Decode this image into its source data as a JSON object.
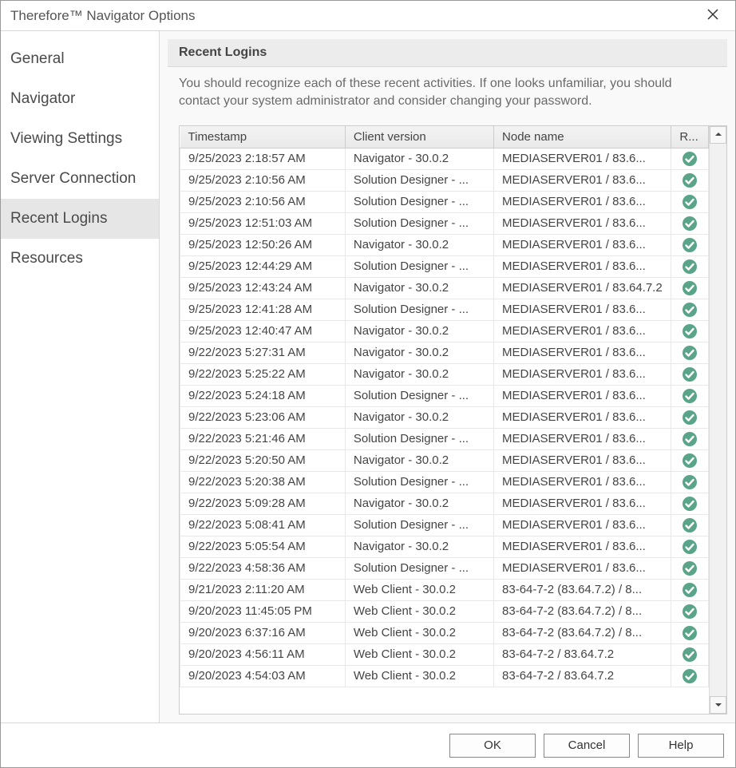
{
  "window": {
    "title": "Therefore™ Navigator Options"
  },
  "sidebar": {
    "items": [
      {
        "label": "General"
      },
      {
        "label": "Navigator"
      },
      {
        "label": "Viewing Settings"
      },
      {
        "label": "Server Connection"
      },
      {
        "label": "Recent Logins"
      },
      {
        "label": "Resources"
      }
    ],
    "active_index": 4
  },
  "main": {
    "heading": "Recent Logins",
    "description": "You should recognize each of these recent activities. If one looks unfamiliar, you should contact your system administrator and consider changing your password.",
    "columns": {
      "timestamp": "Timestamp",
      "client_version": "Client version",
      "node_name": "Node name",
      "result": "R..."
    },
    "rows": [
      {
        "ts": "9/25/2023 2:18:57 AM",
        "cv": "Navigator - 30.0.2",
        "nn": "MEDIASERVER01 / 83.6...",
        "ok": true
      },
      {
        "ts": "9/25/2023 2:10:56 AM",
        "cv": "Solution Designer - ...",
        "nn": "MEDIASERVER01 / 83.6...",
        "ok": true
      },
      {
        "ts": "9/25/2023 2:10:56 AM",
        "cv": "Solution Designer - ...",
        "nn": "MEDIASERVER01 / 83.6...",
        "ok": true
      },
      {
        "ts": "9/25/2023 12:51:03 AM",
        "cv": "Solution Designer - ...",
        "nn": "MEDIASERVER01 / 83.6...",
        "ok": true
      },
      {
        "ts": "9/25/2023 12:50:26 AM",
        "cv": "Navigator - 30.0.2",
        "nn": "MEDIASERVER01 / 83.6...",
        "ok": true
      },
      {
        "ts": "9/25/2023 12:44:29 AM",
        "cv": "Solution Designer - ...",
        "nn": "MEDIASERVER01 / 83.6...",
        "ok": true
      },
      {
        "ts": "9/25/2023 12:43:24 AM",
        "cv": "Navigator - 30.0.2",
        "nn": "MEDIASERVER01 / 83.64.7.2",
        "ok": true,
        "highlight": true
      },
      {
        "ts": "9/25/2023 12:41:28 AM",
        "cv": "Solution Designer - ...",
        "nn": "MEDIASERVER01 / 83.6...",
        "ok": true
      },
      {
        "ts": "9/25/2023 12:40:47 AM",
        "cv": "Navigator - 30.0.2",
        "nn": "MEDIASERVER01 / 83.6...",
        "ok": true
      },
      {
        "ts": "9/22/2023 5:27:31 AM",
        "cv": "Navigator - 30.0.2",
        "nn": "MEDIASERVER01 / 83.6...",
        "ok": true
      },
      {
        "ts": "9/22/2023 5:25:22 AM",
        "cv": "Navigator - 30.0.2",
        "nn": "MEDIASERVER01 / 83.6...",
        "ok": true
      },
      {
        "ts": "9/22/2023 5:24:18 AM",
        "cv": "Solution Designer - ...",
        "nn": "MEDIASERVER01 / 83.6...",
        "ok": true
      },
      {
        "ts": "9/22/2023 5:23:06 AM",
        "cv": "Navigator - 30.0.2",
        "nn": "MEDIASERVER01 / 83.6...",
        "ok": true
      },
      {
        "ts": "9/22/2023 5:21:46 AM",
        "cv": "Solution Designer - ...",
        "nn": "MEDIASERVER01 / 83.6...",
        "ok": true
      },
      {
        "ts": "9/22/2023 5:20:50 AM",
        "cv": "Navigator - 30.0.2",
        "nn": "MEDIASERVER01 / 83.6...",
        "ok": true
      },
      {
        "ts": "9/22/2023 5:20:38 AM",
        "cv": "Solution Designer - ...",
        "nn": "MEDIASERVER01 / 83.6...",
        "ok": true
      },
      {
        "ts": "9/22/2023 5:09:28 AM",
        "cv": "Navigator - 30.0.2",
        "nn": "MEDIASERVER01 / 83.6...",
        "ok": true
      },
      {
        "ts": "9/22/2023 5:08:41 AM",
        "cv": "Solution Designer - ...",
        "nn": "MEDIASERVER01 / 83.6...",
        "ok": true
      },
      {
        "ts": "9/22/2023 5:05:54 AM",
        "cv": "Navigator - 30.0.2",
        "nn": "MEDIASERVER01 / 83.6...",
        "ok": true
      },
      {
        "ts": "9/22/2023 4:58:36 AM",
        "cv": "Solution Designer - ...",
        "nn": "MEDIASERVER01 / 83.6...",
        "ok": true
      },
      {
        "ts": "9/21/2023 2:11:20 AM",
        "cv": "Web Client - 30.0.2",
        "nn": "83-64-7-2 (83.64.7.2) / 8...",
        "ok": true
      },
      {
        "ts": "9/20/2023 11:45:05 PM",
        "cv": "Web Client - 30.0.2",
        "nn": "83-64-7-2 (83.64.7.2) / 8...",
        "ok": true
      },
      {
        "ts": "9/20/2023 6:37:16 AM",
        "cv": "Web Client - 30.0.2",
        "nn": "83-64-7-2 (83.64.7.2) / 8...",
        "ok": true
      },
      {
        "ts": "9/20/2023 4:56:11 AM",
        "cv": "Web Client - 30.0.2",
        "nn": "83-64-7-2 / 83.64.7.2",
        "ok": true
      },
      {
        "ts": "9/20/2023 4:54:03 AM",
        "cv": "Web Client - 30.0.2",
        "nn": "83-64-7-2 / 83.64.7.2",
        "ok": true
      }
    ]
  },
  "footer": {
    "ok": "OK",
    "cancel": "Cancel",
    "help": "Help"
  },
  "colors": {
    "check_fill": "#5aa589"
  }
}
